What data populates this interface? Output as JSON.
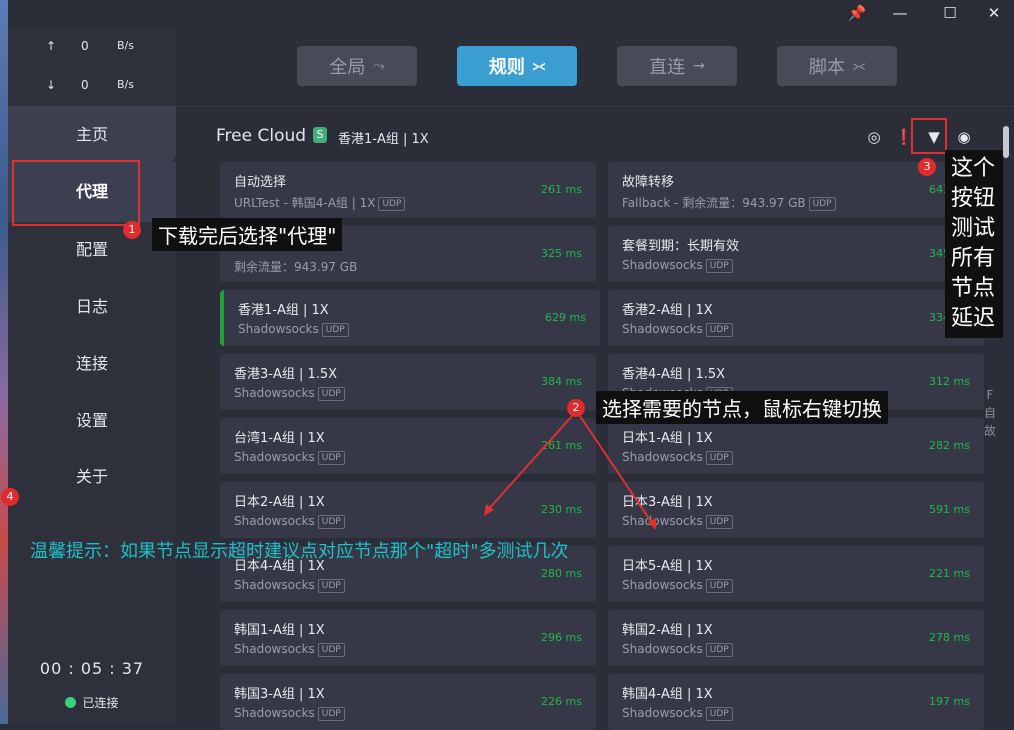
{
  "window": {
    "pin_icon": "pin-icon",
    "minimize_icon": "minimize-icon",
    "maximize_icon": "maximize-icon",
    "close_icon": "close-icon"
  },
  "traffic": {
    "up_arrow": "↑",
    "up_value": "0",
    "up_unit": "B/s",
    "down_arrow": "↓",
    "down_value": "0",
    "down_unit": "B/s"
  },
  "nav": {
    "items": [
      "主页",
      "代理",
      "配置",
      "日志",
      "连接",
      "设置",
      "关于"
    ],
    "active": "代理"
  },
  "status": {
    "timer": "00 : 05 : 37",
    "connection": "已连接",
    "connection_color": "#3ccf7a"
  },
  "modes": [
    {
      "label": "全局",
      "icon": "⤳"
    },
    {
      "label": "规则",
      "icon": "⪥"
    },
    {
      "label": "直连",
      "icon": "→"
    },
    {
      "label": "脚本",
      "icon": "⪥"
    }
  ],
  "active_mode": "规则",
  "group": {
    "title": "Free Cloud",
    "badge": "S",
    "selected": "香港1-A组 | 1X",
    "icons": [
      "latency-target-icon",
      "info-icon",
      "wifi-test-icon",
      "eye-icon"
    ]
  },
  "nodes_left": [
    {
      "name": "自动选择",
      "type": "URLTest - 韩国4-A组 | 1X",
      "udp": "UDP",
      "latency": "261 ms"
    },
    {
      "name": "",
      "type": "剩余流量：943.97 GB",
      "udp": "",
      "latency": "325 ms"
    },
    {
      "name": "香港1-A组 | 1X",
      "type": "Shadowsocks",
      "udp": "UDP",
      "latency": "629 ms"
    },
    {
      "name": "香港3-A组 | 1.5X",
      "type": "Shadowsocks",
      "udp": "UDP",
      "latency": "384 ms"
    },
    {
      "name": "台湾1-A组 | 1X",
      "type": "Shadowsocks",
      "udp": "UDP",
      "latency": "261 ms"
    },
    {
      "name": "日本2-A组 | 1X",
      "type": "Shadowsocks",
      "udp": "UDP",
      "latency": "230 ms"
    },
    {
      "name": "日本4-A组 | 1X",
      "type": "Shadowsocks",
      "udp": "UDP",
      "latency": "280 ms"
    },
    {
      "name": "韩国1-A组 | 1X",
      "type": "Shadowsocks",
      "udp": "UDP",
      "latency": "296 ms"
    },
    {
      "name": "韩国3-A组 | 1X",
      "type": "Shadowsocks",
      "udp": "UDP",
      "latency": "226 ms"
    }
  ],
  "nodes_right": [
    {
      "name": "故障转移",
      "type": "Fallback - 剩余流量：943.97 GB",
      "udp": "UDP",
      "latency": "643 ms"
    },
    {
      "name": "套餐到期：长期有效",
      "type": "Shadowsocks",
      "udp": "UDP",
      "latency": "345 ms"
    },
    {
      "name": "香港2-A组 | 1X",
      "type": "Shadowsocks",
      "udp": "UDP",
      "latency": "334 ms"
    },
    {
      "name": "香港4-A组 | 1.5X",
      "type": "Shadowsocks",
      "udp": "UDP",
      "latency": "312 ms"
    },
    {
      "name": "日本1-A组 | 1X",
      "type": "Shadowsocks",
      "udp": "UDP",
      "latency": "282 ms"
    },
    {
      "name": "日本3-A组 | 1X",
      "type": "Shadowsocks",
      "udp": "UDP",
      "latency": "591 ms"
    },
    {
      "name": "日本5-A组 | 1X",
      "type": "Shadowsocks",
      "udp": "UDP",
      "latency": "221 ms"
    },
    {
      "name": "韩国2-A组 | 1X",
      "type": "Shadowsocks",
      "udp": "UDP",
      "latency": "278 ms"
    },
    {
      "name": "韩国4-A组 | 1X",
      "type": "Shadowsocks",
      "udp": "UDP",
      "latency": "197 ms"
    }
  ],
  "side_strip": [
    "F",
    "自",
    "故"
  ],
  "annotations": {
    "n1": "1",
    "t1": "下载完后选择\"代理\"",
    "n2": "2",
    "t2": "选择需要的节点，鼠标右键切换",
    "n3": "3",
    "t3": "这个按钮测试所有节点延迟",
    "n4": "4",
    "t4": "温馨提示：如果节点显示超时建议点对应节点那个\"超时\"多测试几次",
    "color": "#e03030"
  }
}
